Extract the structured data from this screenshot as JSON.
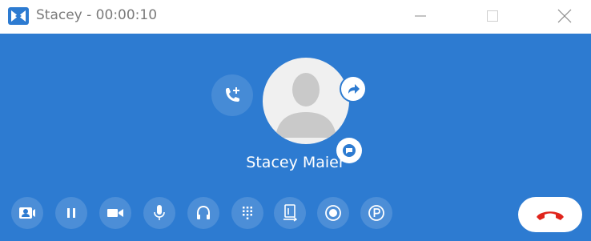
{
  "window": {
    "title": "Stacey - 00:00:10",
    "logo_icon": "app-logo-icon",
    "minimize_icon": "minimize-icon",
    "maximize_icon": "maximize-icon",
    "close_icon": "close-icon"
  },
  "call": {
    "caller_name": "Stacey Maier",
    "background_color": "#2d7bd1",
    "hangup_color": "#e0241b"
  },
  "avatar": {
    "forward_icon": "forward-icon",
    "chat_icon": "chat-icon"
  },
  "actions": {
    "add_call_icon": "add-call-icon"
  },
  "controls": [
    {
      "name": "contact-card",
      "icon": "contact-card-icon"
    },
    {
      "name": "hold",
      "icon": "pause-icon"
    },
    {
      "name": "video",
      "icon": "video-camera-icon"
    },
    {
      "name": "mute",
      "icon": "microphone-icon"
    },
    {
      "name": "audio-device",
      "icon": "headset-icon"
    },
    {
      "name": "dialpad",
      "icon": "dialpad-icon"
    },
    {
      "name": "transfer",
      "icon": "transfer-icon"
    },
    {
      "name": "record",
      "icon": "record-icon"
    },
    {
      "name": "park",
      "icon": "park-icon"
    },
    {
      "name": "hang-up",
      "icon": "hang-up-icon"
    }
  ]
}
